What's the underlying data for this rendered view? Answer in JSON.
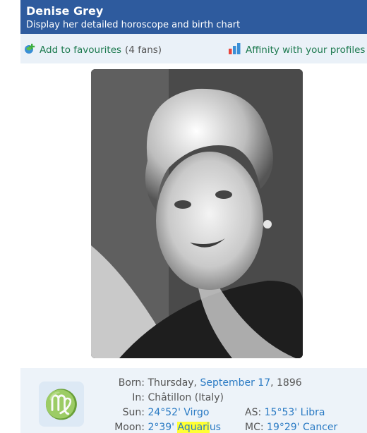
{
  "header": {
    "name": "Denise Grey",
    "subtitle": "Display her detailed horoscope and birth chart"
  },
  "actions": {
    "favourites_label": "Add to favourites",
    "favourites_count": "(4 fans)",
    "affinity_label": "Affinity with your profiles"
  },
  "photo": {
    "alt": "Denise Grey"
  },
  "sign": {
    "symbol": "♍"
  },
  "info": {
    "born_label": "Born:",
    "born_day": "Thursday,",
    "born_date": "September 17",
    "born_year": ", 1896",
    "in_label": "In:",
    "in_value": "Châtillon (Italy)",
    "sun_label": "Sun:",
    "sun_value": "24°52' Virgo",
    "as_label": "AS:",
    "as_value": "15°53' Libra",
    "moon_label": "Moon:",
    "moon_value_prefix": "2°39'",
    "moon_sign_hl": "Aquari",
    "moon_sign_rest": "us",
    "mc_label": "MC:",
    "mc_value": "19°29' Cancer"
  },
  "colors": {
    "header_bg": "#2e5b9e",
    "action_green": "#1d7a4f",
    "link_blue": "#2b7bc4",
    "highlight": "#ffff33",
    "info_bg": "#edf3f9"
  }
}
